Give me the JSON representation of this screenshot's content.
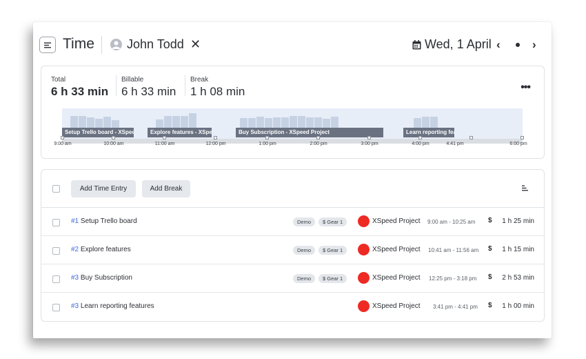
{
  "header": {
    "title": "Time",
    "user_name": "John Todd",
    "close_symbol": "✕",
    "date": "Wed, 1 April",
    "prev_symbol": "‹",
    "next_symbol": "›"
  },
  "summary": {
    "total_label": "Total",
    "total_value": "6 h 33 min",
    "billable_label": "Billable",
    "billable_value": "6 h 33 min",
    "break_label": "Break",
    "break_value": "1 h 08 min",
    "more_symbol": "•••"
  },
  "timeline": {
    "segments": [
      "Setup Trello board - XSpeed Project",
      "Explore features - XSpeed Project",
      "Buy Subscription - XSpeed Project",
      "Learn reporting features - XSpeed Project"
    ],
    "tick_labels": [
      "9:00 am",
      "10:00 am",
      "11:00 am",
      "12:00 pm",
      "1:00 pm",
      "2:00 pm",
      "3:00 pm",
      "4:00 pm",
      "4:41 pm",
      "6:00 pm"
    ]
  },
  "toolbar": {
    "add_time_entry": "Add Time Entry",
    "add_break": "Add Break"
  },
  "entries": [
    {
      "num": "#1",
      "title": "Setup Trello board",
      "tags": [
        "Demo",
        "$ Gear 1"
      ],
      "project": "XSpeed Project",
      "range": "9:00 am - 10:25 am",
      "billable_symbol": "$",
      "duration": "1 h 25 min"
    },
    {
      "num": "#2",
      "title": "Explore features",
      "tags": [
        "Demo",
        "$ Gear 1"
      ],
      "project": "XSpeed Project",
      "range": "10:41 am - 11:56 am",
      "billable_symbol": "$",
      "duration": "1 h 15 min"
    },
    {
      "num": "#3",
      "title": "Buy Subscription",
      "tags": [
        "Demo",
        "$ Gear 1"
      ],
      "project": "XSpeed Project",
      "range": "12:25 pm - 3:18 pm",
      "billable_symbol": "$",
      "duration": "2 h 53 min"
    },
    {
      "num": "#3",
      "title": "Learn reporting features",
      "tags": [],
      "project": "XSpeed Project",
      "range": "3:41 pm - 4:41 pm",
      "billable_symbol": "$",
      "duration": "1 h 00 min"
    }
  ],
  "colors": {
    "project": "#ee2a24",
    "entry_number": "#3f6ad8",
    "timeline_bg": "#e8eef8",
    "timeline_bar": "#c6d2e4",
    "segment": "#6a7282"
  },
  "icons": [
    "menu-icon",
    "user-icon",
    "close-icon",
    "calendar-icon",
    "chevron-left-icon",
    "dot-icon",
    "chevron-right-icon",
    "more-icon",
    "sort-icon"
  ]
}
